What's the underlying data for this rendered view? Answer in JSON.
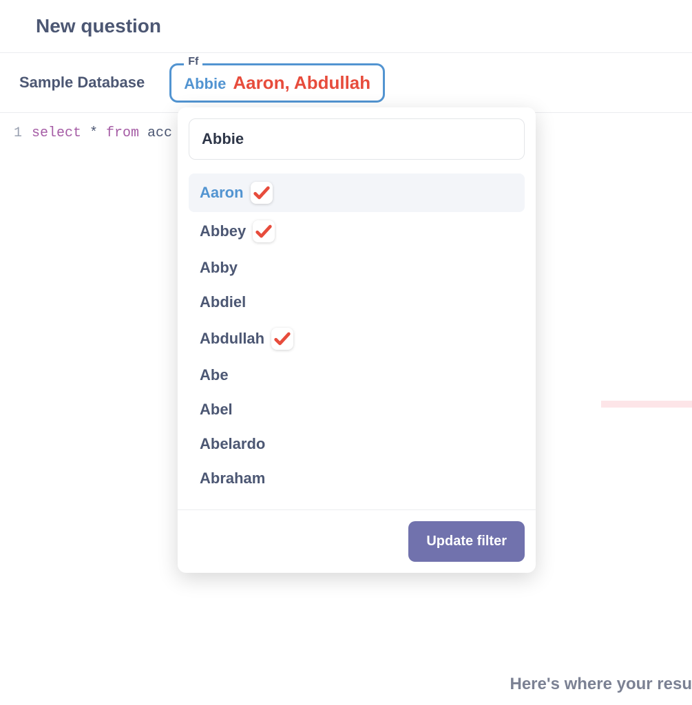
{
  "header": {
    "title": "New question"
  },
  "toolbar": {
    "database": "Sample Database",
    "filter": {
      "label": "Ff",
      "current": "Abbie",
      "overlay": "Aaron, Abdullah"
    }
  },
  "editor": {
    "line_number": "1",
    "keywords": [
      "select",
      "from"
    ],
    "star": " * ",
    "identifier": " acc"
  },
  "dropdown": {
    "search_value": "Abbie",
    "items": [
      {
        "label": "Aaron",
        "checked": true,
        "active": true
      },
      {
        "label": "Abbey",
        "checked": true,
        "active": false
      },
      {
        "label": "Abby",
        "checked": false,
        "active": false
      },
      {
        "label": "Abdiel",
        "checked": false,
        "active": false
      },
      {
        "label": "Abdullah",
        "checked": true,
        "active": false
      },
      {
        "label": "Abe",
        "checked": false,
        "active": false
      },
      {
        "label": "Abel",
        "checked": false,
        "active": false
      },
      {
        "label": "Abelardo",
        "checked": false,
        "active": false
      },
      {
        "label": "Abraham",
        "checked": false,
        "active": false
      }
    ],
    "button": "Update filter"
  },
  "footer": {
    "hint": "Here's where your resu"
  }
}
